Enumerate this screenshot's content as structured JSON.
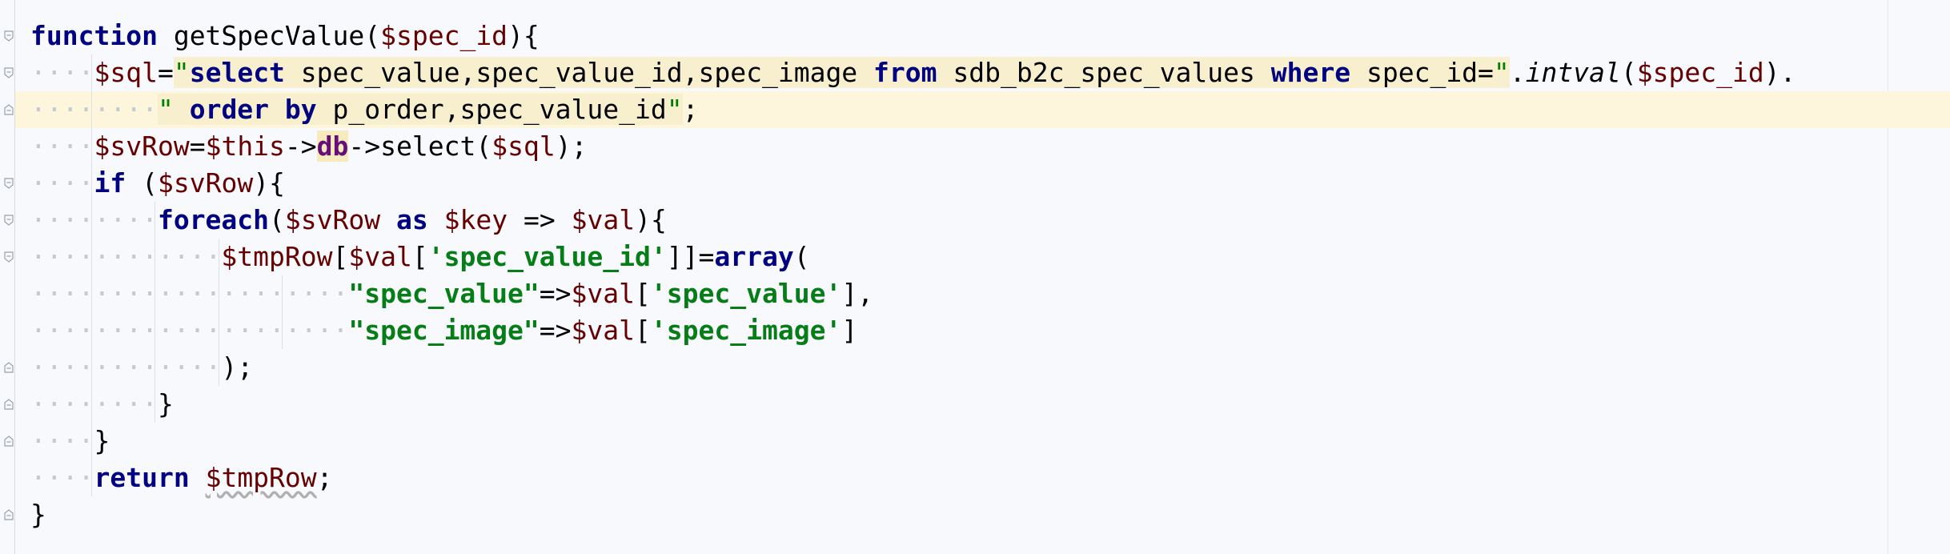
{
  "editor": {
    "language": "php",
    "lines": [
      {
        "tokens": [
          {
            "t": "function",
            "c": "kw"
          },
          {
            "t": " getSpecValue(",
            "c": ""
          },
          {
            "t": "$spec_id",
            "c": "var"
          },
          {
            "t": "){",
            "c": ""
          }
        ]
      },
      {
        "indent": 1,
        "tokens": [
          {
            "t": "$sql",
            "c": "var"
          },
          {
            "t": "=",
            "c": ""
          },
          {
            "t": "\"",
            "c": "sqlq"
          },
          {
            "t": "select",
            "c": "sqlkw"
          },
          {
            "t": " spec_value,spec_value_id,spec_image ",
            "c": "sqltxt"
          },
          {
            "t": "from",
            "c": "sqlkw"
          },
          {
            "t": " sdb_b2c_spec_values ",
            "c": "sqltxt"
          },
          {
            "t": "where",
            "c": "sqlkw"
          },
          {
            "t": " spec_id=",
            "c": "sqltxt"
          },
          {
            "t": "\"",
            "c": "sqlq"
          },
          {
            "t": ".",
            "c": ""
          },
          {
            "t": "intval",
            "c": "fn"
          },
          {
            "t": "(",
            "c": ""
          },
          {
            "t": "$spec_id",
            "c": "var"
          },
          {
            "t": ").",
            "c": ""
          }
        ]
      },
      {
        "indent": 2,
        "caret": true,
        "tokens": [
          {
            "t": "\"",
            "c": "sqlq"
          },
          {
            "t": " ",
            "c": "sqltxt"
          },
          {
            "t": "order by",
            "c": "sqlkw"
          },
          {
            "t": " p_order,spec_value_id",
            "c": "sqltxt"
          },
          {
            "t": "\"",
            "c": "sqlq"
          },
          {
            "t": ";",
            "c": ""
          }
        ]
      },
      {
        "indent": 1,
        "tokens": [
          {
            "t": "$svRow",
            "c": "var"
          },
          {
            "t": "=",
            "c": ""
          },
          {
            "t": "$this",
            "c": "var"
          },
          {
            "t": "->",
            "c": ""
          },
          {
            "t": "db",
            "c": "prop"
          },
          {
            "t": "->select(",
            "c": ""
          },
          {
            "t": "$sql",
            "c": "var"
          },
          {
            "t": ");",
            "c": ""
          }
        ]
      },
      {
        "indent": 1,
        "tokens": [
          {
            "t": "if",
            "c": "kw"
          },
          {
            "t": " (",
            "c": ""
          },
          {
            "t": "$svRow",
            "c": "var"
          },
          {
            "t": "){",
            "c": ""
          }
        ]
      },
      {
        "indent": 2,
        "tokens": [
          {
            "t": "foreach",
            "c": "kw"
          },
          {
            "t": "(",
            "c": ""
          },
          {
            "t": "$svRow",
            "c": "var"
          },
          {
            "t": " ",
            "c": ""
          },
          {
            "t": "as",
            "c": "kw"
          },
          {
            "t": " ",
            "c": ""
          },
          {
            "t": "$key",
            "c": "var"
          },
          {
            "t": " => ",
            "c": ""
          },
          {
            "t": "$val",
            "c": "var"
          },
          {
            "t": "){",
            "c": ""
          }
        ]
      },
      {
        "indent": 3,
        "tokens": [
          {
            "t": "$tmpRow",
            "c": "var"
          },
          {
            "t": "[",
            "c": ""
          },
          {
            "t": "$val",
            "c": "var"
          },
          {
            "t": "[",
            "c": ""
          },
          {
            "t": "'spec_value_id'",
            "c": "sqstr"
          },
          {
            "t": "]]=",
            "c": ""
          },
          {
            "t": "array",
            "c": "kw"
          },
          {
            "t": "(",
            "c": ""
          }
        ]
      },
      {
        "indent": 5,
        "tokens": [
          {
            "t": "\"spec_value\"",
            "c": "dqstr"
          },
          {
            "t": "=>",
            "c": ""
          },
          {
            "t": "$val",
            "c": "var"
          },
          {
            "t": "[",
            "c": ""
          },
          {
            "t": "'spec_value'",
            "c": "sqstr"
          },
          {
            "t": "],",
            "c": ""
          }
        ]
      },
      {
        "indent": 5,
        "tokens": [
          {
            "t": "\"spec_image\"",
            "c": "dqstr"
          },
          {
            "t": "=>",
            "c": ""
          },
          {
            "t": "$val",
            "c": "var"
          },
          {
            "t": "[",
            "c": ""
          },
          {
            "t": "'spec_image'",
            "c": "sqstr"
          },
          {
            "t": "]",
            "c": ""
          }
        ]
      },
      {
        "indent": 3,
        "tokens": [
          {
            "t": ");",
            "c": ""
          }
        ]
      },
      {
        "indent": 2,
        "tokens": [
          {
            "t": "}",
            "c": ""
          }
        ]
      },
      {
        "indent": 1,
        "tokens": [
          {
            "t": "}",
            "c": ""
          }
        ]
      },
      {
        "indent": 1,
        "tokens": [
          {
            "t": "return",
            "c": "kw"
          },
          {
            "t": " ",
            "c": ""
          },
          {
            "t": "$tmpRow",
            "c": "var warn"
          },
          {
            "t": ";",
            "c": ""
          }
        ]
      },
      {
        "tokens": [
          {
            "t": "}",
            "c": ""
          }
        ]
      }
    ]
  }
}
